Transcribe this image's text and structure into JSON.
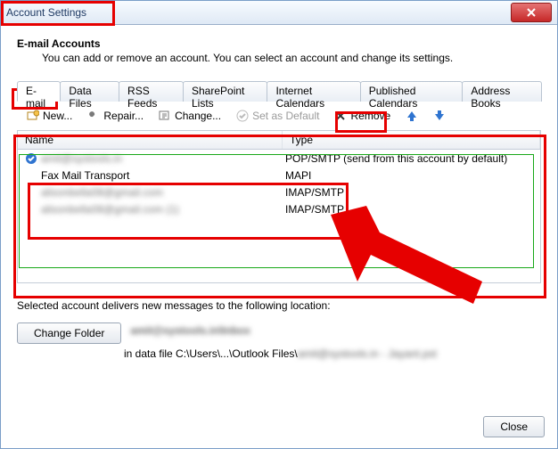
{
  "window": {
    "title": "Account Settings"
  },
  "header": {
    "title": "E-mail Accounts",
    "desc": "You can add or remove an account. You can select an account and change its settings."
  },
  "tabs": {
    "email": "E-mail",
    "datafiles": "Data Files",
    "rss": "RSS Feeds",
    "sharepoint": "SharePoint Lists",
    "ical": "Internet Calendars",
    "pubcal": "Published Calendars",
    "addr": "Address Books"
  },
  "toolbar": {
    "new": "New...",
    "repair": "Repair...",
    "change": "Change...",
    "set_default": "Set as Default",
    "remove": "Remove"
  },
  "columns": {
    "name": "Name",
    "type": "Type"
  },
  "accounts": [
    {
      "name": "amit@systools.in",
      "blur": true,
      "type": "POP/SMTP (send from this account by default)",
      "default": true
    },
    {
      "name": "Fax Mail Transport",
      "blur": false,
      "type": "MAPI",
      "default": false
    },
    {
      "name": "alisonbella08@gmail.com",
      "blur": true,
      "type": "IMAP/SMTP",
      "default": false
    },
    {
      "name": "alisonbella08@gmail.com (1)",
      "blur": true,
      "type": "IMAP/SMTP",
      "default": false
    }
  ],
  "location": {
    "intro": "Selected account delivers new messages to the following location:",
    "change_folder": "Change Folder",
    "path_account": "amit@systools.in\\Inbox",
    "path_file_prefix": "in data file C:\\Users\\...\\Outlook Files\\",
    "path_file_blur": "amit@systools.in - Jayant.pst"
  },
  "footer": {
    "close": "Close"
  }
}
